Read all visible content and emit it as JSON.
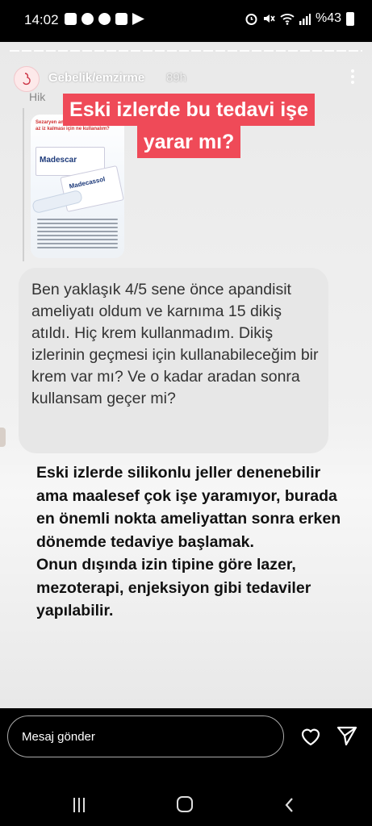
{
  "status_bar": {
    "time": "14:02",
    "battery": "%43",
    "icons": [
      "g-icon",
      "notification-dot-icon",
      "instagram-icon",
      "gallery-icon",
      "play-store-icon",
      "alarm-icon",
      "mute-icon",
      "wifi-icon",
      "signal-icon",
      "battery-icon"
    ]
  },
  "story": {
    "username": "Gebelik/emzirme",
    "time_ago": "89h",
    "reply_prefix": "Hik",
    "question_lines": [
      "Eski izlerde bu tedavi işe",
      "yarar mı?"
    ],
    "question_bg_color": "#ef4a58",
    "thumbnail": {
      "headline": "Sezaryen ameliyatından sonra daha az iz kalması için ne kullanalım?",
      "brand1": "Madescar",
      "brand2": "Madecassol"
    },
    "user_message": "Ben yaklaşık 4/5 sene önce apandisit ameliyatı oldum ve karnıma 15 dikiş atıldı. Hiç krem kullanmadım. Dikiş izlerinin geçmesi için kullanabileceğim bir krem var mı? Ve o kadar aradan sonra kullansam geçer mi?",
    "answer_paragraphs": [
      "Eski izlerde silikonlu jeller denenebilir ama maalesef çok işe yaramıyor, burada en önemli nokta ameliyattan sonra erken dönemde tedaviye başlamak.",
      "Onun dışında izin tipine göre lazer, mezoterapi, enjeksiyon gibi tedaviler yapılabilir."
    ]
  },
  "bottom_bar": {
    "message_placeholder": "Mesaj gönder"
  }
}
